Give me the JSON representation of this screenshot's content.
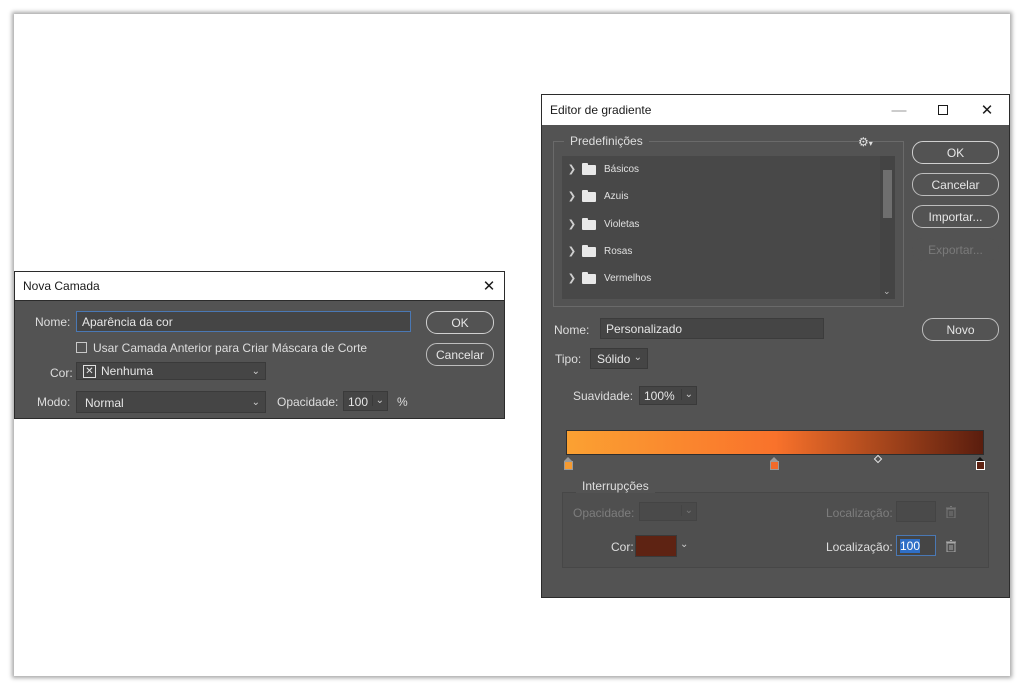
{
  "nova_camada": {
    "title": "Nova Camada",
    "nome_label": "Nome:",
    "nome_value": "Aparência da cor",
    "clip_label": "Usar Camada Anterior para Criar Máscara de Corte",
    "cor_label": "Cor:",
    "cor_value": "Nenhuma",
    "modo_label": "Modo:",
    "modo_value": "Normal",
    "opacidade_label": "Opacidade:",
    "opacidade_value": "100",
    "percent": "%",
    "ok_label": "OK",
    "cancel_label": "Cancelar"
  },
  "editor": {
    "title": "Editor de gradiente",
    "presets_label": "Predefinições",
    "presets": [
      {
        "label": "Básicos"
      },
      {
        "label": "Azuis"
      },
      {
        "label": "Violetas"
      },
      {
        "label": "Rosas"
      },
      {
        "label": "Vermelhos"
      }
    ],
    "ok_label": "OK",
    "cancel_label": "Cancelar",
    "import_label": "Importar...",
    "export_label": "Exportar...",
    "nome_label": "Nome:",
    "nome_value": "Personalizado",
    "novo_label": "Novo",
    "tipo_label": "Tipo:",
    "tipo_value": "Sólido",
    "suavidade_label": "Suavidade:",
    "suavidade_value": "100%",
    "gradient_colors": [
      "#fba132",
      "#f9722b",
      "#5a1d0e"
    ],
    "interrupcoes_label": "Interrupções",
    "opacidade_label": "Opacidade:",
    "localizacao_label_1": "Localização:",
    "cor_label": "Cor:",
    "color_stop_value": "#5e2313",
    "localizacao_label_2": "Localização:",
    "localizacao_value": "100"
  }
}
